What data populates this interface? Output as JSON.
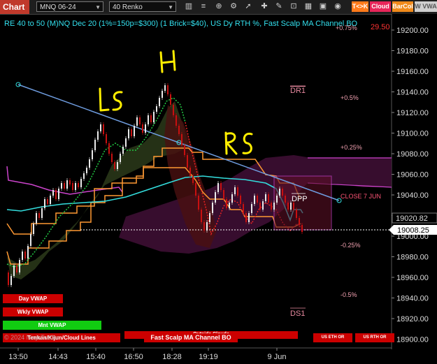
{
  "toolbar": {
    "tab_label": "Chart",
    "instrument": "MNQ 06-24",
    "period": "40 Renko",
    "badge_tk": "T<>K",
    "badge_cloud": "Cloud",
    "badge_barcol": "BarCol",
    "badge_vwap": "W VWA"
  },
  "header": {
    "title": "RE 40 to 50 (M)NQ Dec 20 (1%=150p=$300) (1 Brick=$40), US Dy RTH %, Fast Scalp MA Channel BO",
    "top_right_value": "29.50",
    "top_right_pct": "+0.75%"
  },
  "price_axis": {
    "ticks": [
      "19200.00",
      "19180.00",
      "19160.00",
      "19140.00",
      "19120.00",
      "19100.00",
      "19080.00",
      "19060.00",
      "19040.00",
      "19020.00",
      "19000.00",
      "18980.00",
      "18960.00",
      "18940.00",
      "18920.00",
      "18900.00"
    ],
    "current_price": "19020.82",
    "marker_price": "19008.25"
  },
  "time_axis": {
    "ticks": [
      "13:50",
      "14:43",
      "15:40",
      "16:50",
      "18:28",
      "19:19",
      "9 Jun"
    ]
  },
  "annotations": {
    "h": "H",
    "ls": "LS",
    "rs": "RS",
    "dr1": "DR1",
    "ds1": "DS1",
    "dpp": "DPP",
    "close": "CLOSE 7 JUN",
    "p05": "+0.5%",
    "p025": "+0.25%",
    "m025": "-0.25%",
    "m05": "-0.5%"
  },
  "buttons": {
    "day_vwap": "Day VWAP",
    "wkly_vwap": "Wkly VWAP",
    "mnt_vwap": "Mnt VWAP",
    "cloud_lines": "Tenkan/Kijun/Cloud Lines",
    "fast_scalp": "Fast Scalp MA Channel BO",
    "outside_clouds": "Outside Clouds",
    "us_eth_or": "US ETH OR",
    "us_rth_or": "US RTH OR",
    "copyright": "© 2024 NinjaTrader"
  },
  "colors": {
    "up_brick": "#ffffff",
    "down_brick": "#dd1111",
    "trend_line": "#6f9de0",
    "cyan_ma": "#33dddd",
    "orange_channel": "#ff9933",
    "cloud_magenta": "#cc44cc",
    "button_red": "#cc0000",
    "button_green": "#11cc11"
  }
}
